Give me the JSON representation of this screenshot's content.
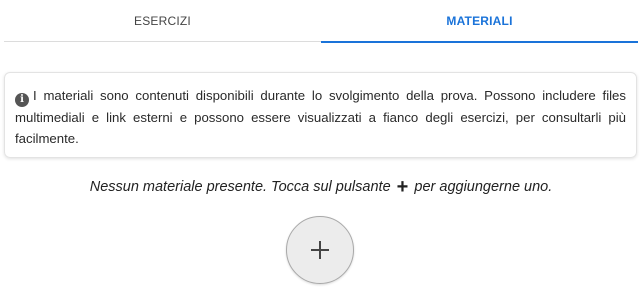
{
  "tabs": {
    "esercizi": "ESERCIZI",
    "materiali": "MATERIALI",
    "active": "materiali"
  },
  "info": {
    "icon": "info-icon",
    "text": "I materiali sono contenuti disponibili durante lo svolgimento della prova. Possono includere files multimediali e link esterni e possono essere visualizzati a fianco degli esercizi, per consultarli più facilmente."
  },
  "empty_state": {
    "message_before": "Nessun materiale presente. Tocca sul pulsante",
    "plus_icon": "plus-icon",
    "message_after": "per aggiungerne uno."
  },
  "add_button": {
    "icon": "plus-icon"
  },
  "colors": {
    "accent": "#1a73d9",
    "button_bg": "#ececec"
  }
}
